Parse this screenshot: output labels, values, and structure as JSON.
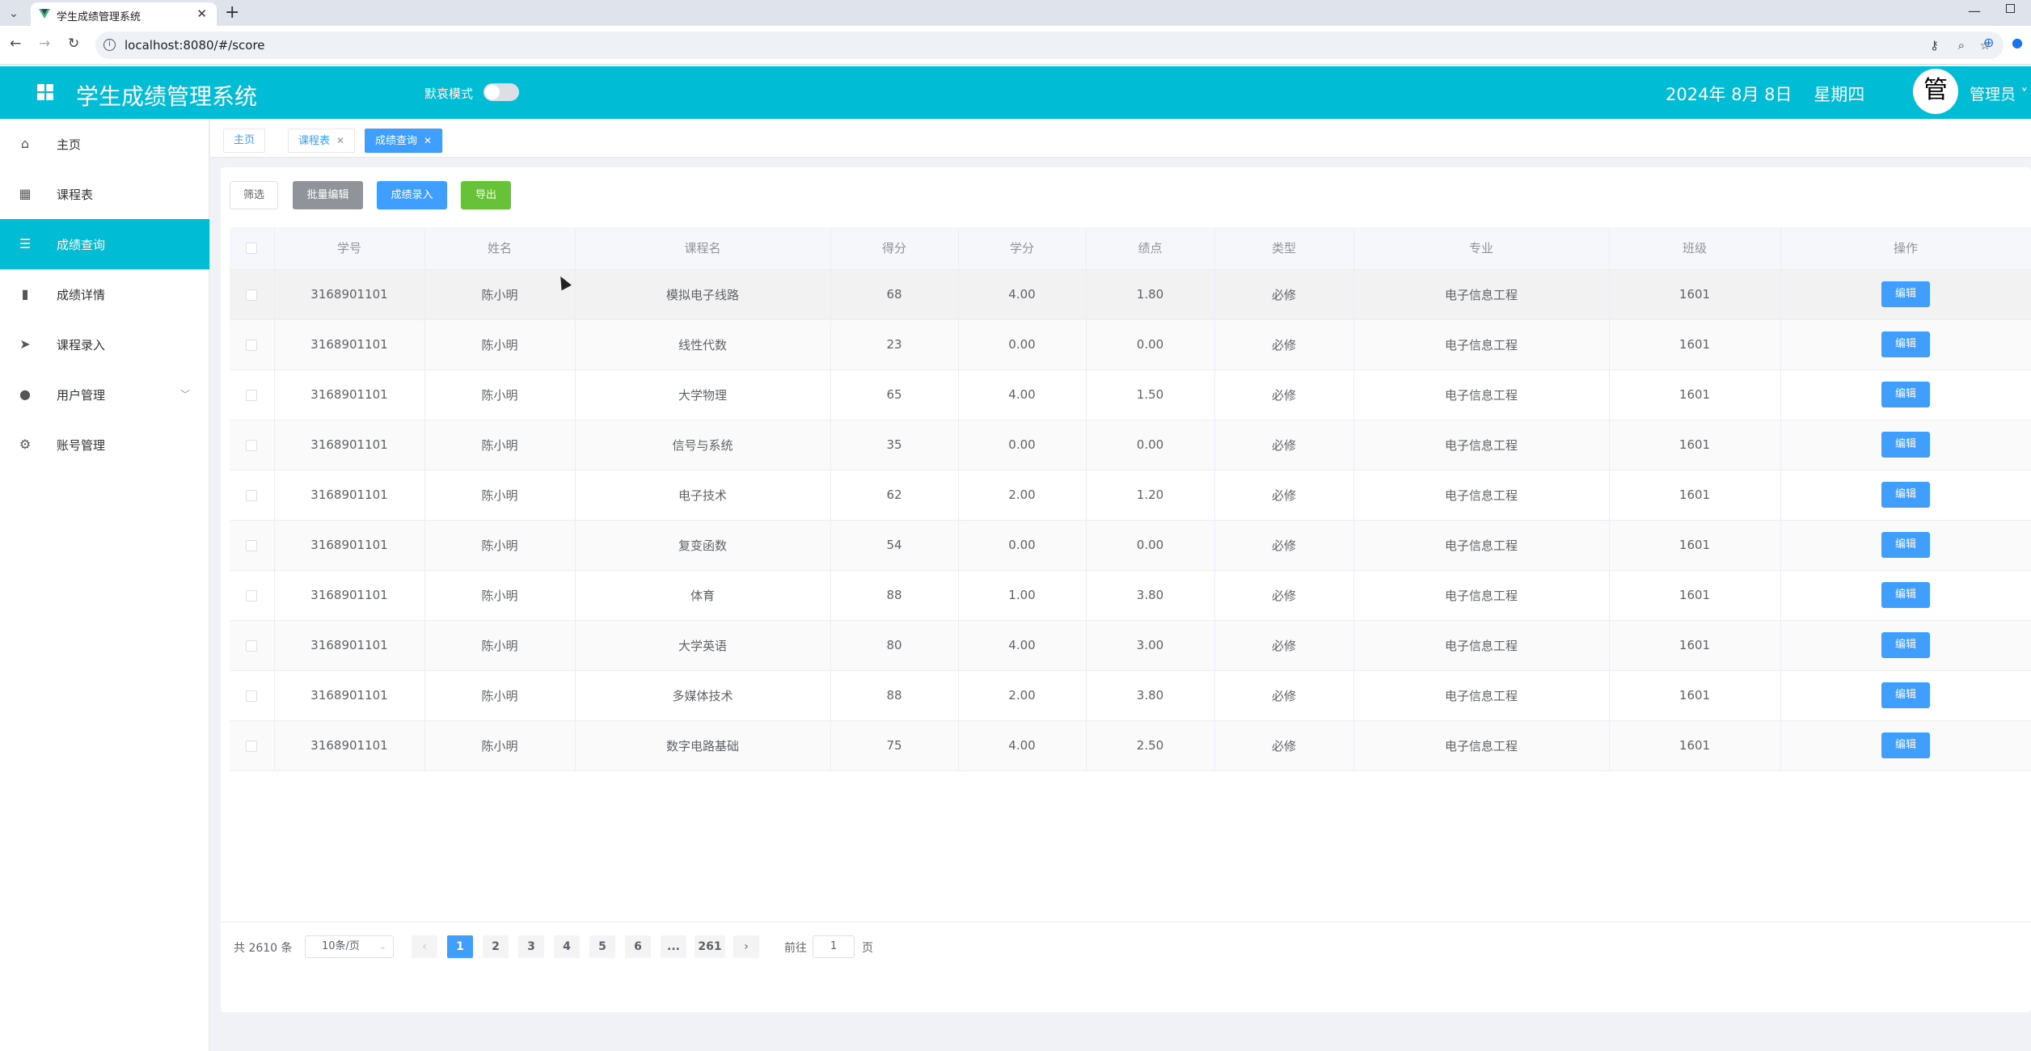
{
  "browser": {
    "tab_title": "学生成绩管理系统",
    "url": "localhost:8080/#/score"
  },
  "header": {
    "app_title": "学生成绩管理系统",
    "dark_mode_label": "默哀模式",
    "dark_mode_on": false,
    "date": "2024年 8月 8日    星期四",
    "avatar_char": "管",
    "user_name": "管理员 ˅",
    "color": "#00bcd4"
  },
  "sidebar": {
    "items": [
      {
        "label": "主页",
        "icon": "home-icon"
      },
      {
        "label": "课程表",
        "icon": "grid-icon"
      },
      {
        "label": "成绩查询",
        "icon": "list-icon",
        "active": true
      },
      {
        "label": "成绩详情",
        "icon": "bar-chart-icon"
      },
      {
        "label": "课程录入",
        "icon": "send-icon"
      },
      {
        "label": "用户管理",
        "icon": "user-icon",
        "expandable": true
      },
      {
        "label": "账号管理",
        "icon": "gear-icon"
      }
    ]
  },
  "tags": [
    {
      "label": "主页",
      "closable": false
    },
    {
      "label": "课程表",
      "closable": true
    },
    {
      "label": "成绩查询",
      "closable": true,
      "active": true
    }
  ],
  "actions": {
    "filter": "筛选",
    "batch_edit": "批量编辑",
    "score_entry": "成绩录入",
    "export": "导出"
  },
  "table": {
    "columns": [
      "学号",
      "姓名",
      "课程名",
      "得分",
      "学分",
      "绩点",
      "类型",
      "专业",
      "班级",
      "操作"
    ],
    "edit_label": "编辑",
    "rows": [
      {
        "id": "3168901101",
        "name": "陈小明",
        "course": "模拟电子线路",
        "score": "68",
        "credit": "4.00",
        "gpa": "1.80",
        "type": "必修",
        "major": "电子信息工程",
        "class": "1601",
        "fail": false
      },
      {
        "id": "3168901101",
        "name": "陈小明",
        "course": "线性代数",
        "score": "23",
        "credit": "0.00",
        "gpa": "0.00",
        "type": "必修",
        "major": "电子信息工程",
        "class": "1601",
        "fail": true
      },
      {
        "id": "3168901101",
        "name": "陈小明",
        "course": "大学物理",
        "score": "65",
        "credit": "4.00",
        "gpa": "1.50",
        "type": "必修",
        "major": "电子信息工程",
        "class": "1601",
        "fail": false
      },
      {
        "id": "3168901101",
        "name": "陈小明",
        "course": "信号与系统",
        "score": "35",
        "credit": "0.00",
        "gpa": "0.00",
        "type": "必修",
        "major": "电子信息工程",
        "class": "1601",
        "fail": true
      },
      {
        "id": "3168901101",
        "name": "陈小明",
        "course": "电子技术",
        "score": "62",
        "credit": "2.00",
        "gpa": "1.20",
        "type": "必修",
        "major": "电子信息工程",
        "class": "1601",
        "fail": false
      },
      {
        "id": "3168901101",
        "name": "陈小明",
        "course": "复变函数",
        "score": "54",
        "credit": "0.00",
        "gpa": "0.00",
        "type": "必修",
        "major": "电子信息工程",
        "class": "1601",
        "fail": true
      },
      {
        "id": "3168901101",
        "name": "陈小明",
        "course": "体育",
        "score": "88",
        "credit": "1.00",
        "gpa": "3.80",
        "type": "必修",
        "major": "电子信息工程",
        "class": "1601",
        "fail": false
      },
      {
        "id": "3168901101",
        "name": "陈小明",
        "course": "大学英语",
        "score": "80",
        "credit": "4.00",
        "gpa": "3.00",
        "type": "必修",
        "major": "电子信息工程",
        "class": "1601",
        "fail": false
      },
      {
        "id": "3168901101",
        "name": "陈小明",
        "course": "多媒体技术",
        "score": "88",
        "credit": "2.00",
        "gpa": "3.80",
        "type": "必修",
        "major": "电子信息工程",
        "class": "1601",
        "fail": false
      },
      {
        "id": "3168901101",
        "name": "陈小明",
        "course": "数字电路基础",
        "score": "75",
        "credit": "4.00",
        "gpa": "2.50",
        "type": "必修",
        "major": "电子信息工程",
        "class": "1601",
        "fail": false
      }
    ]
  },
  "pagination": {
    "total": "共 2610 条",
    "page_size": "10条/页",
    "pages": [
      "1",
      "2",
      "3",
      "4",
      "5",
      "6",
      "...",
      "261"
    ],
    "current": "1",
    "goto_label": "前往",
    "goto_value": "1",
    "page_word": "页"
  },
  "colors": {
    "primary": "#409eff",
    "fail": "#f56c6c",
    "success": "#67c23a",
    "info": "#909399"
  }
}
